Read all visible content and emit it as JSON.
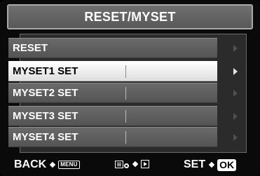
{
  "title": "RESET/MYSET",
  "menu": {
    "items": [
      {
        "label": "RESET"
      },
      {
        "label": "MYSET1 SET",
        "selected": true
      },
      {
        "label": "MYSET2 SET"
      },
      {
        "label": "MYSET3 SET"
      },
      {
        "label": "MYSET4 SET"
      }
    ]
  },
  "footer": {
    "back_label": "BACK",
    "menu_button": "MENU",
    "set_label": "SET",
    "ok_button": "OK"
  },
  "colors": {
    "selected_bg": "#ffffff",
    "item_bg": "#606060",
    "title_bg": "#666666"
  }
}
